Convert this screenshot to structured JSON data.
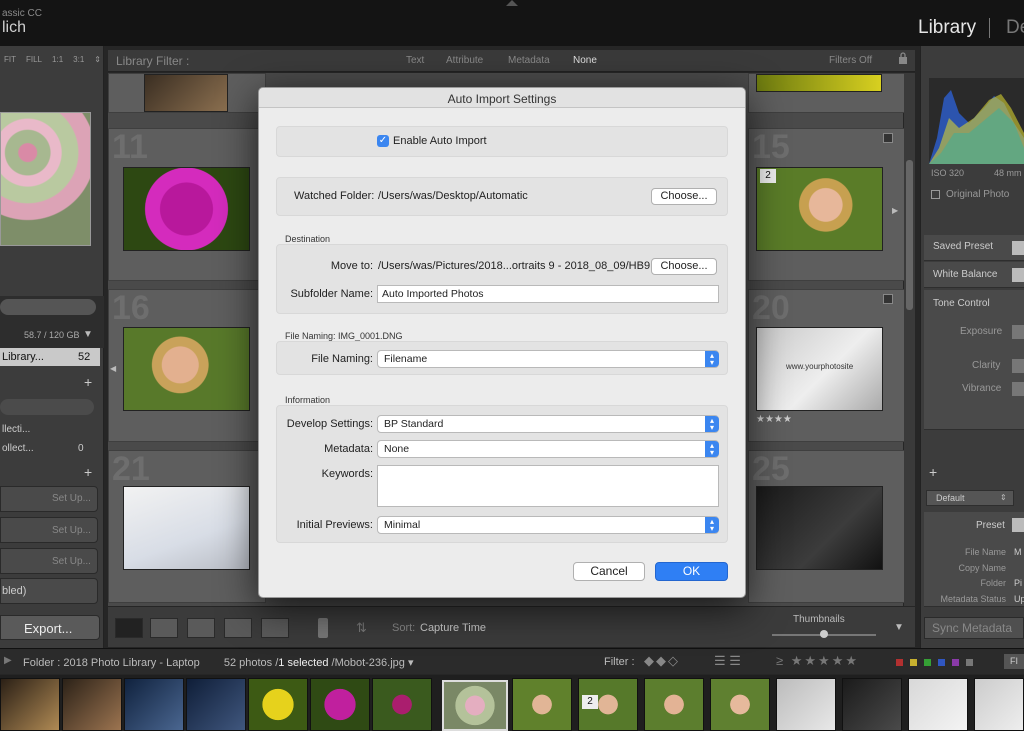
{
  "app": {
    "line1": "assic CC",
    "line2": "lich"
  },
  "modules": {
    "library": "Library",
    "develop": "De"
  },
  "navigator": {
    "modes": [
      "FIT",
      "FILL",
      "1:1",
      "3:1"
    ]
  },
  "left": {
    "storage": "58.7 / 120 GB",
    "library_label": "Library...",
    "library_count": "52",
    "collection1": "llecti...",
    "collection2": "ollect...",
    "collection2_count": "0",
    "setup": [
      "Set Up...",
      "Set Up...",
      "Set Up..."
    ],
    "disabled": "bled)",
    "export": "Export..."
  },
  "filterbar": {
    "title": "Library Filter :",
    "tabs": [
      "Text",
      "Attribute",
      "Metadata",
      "None"
    ],
    "filters_off": "Filters Off"
  },
  "grid": {
    "cell_numbers": [
      "11",
      "15",
      "16",
      "20",
      "21",
      "25"
    ],
    "stars": "★★★★",
    "cell_badge": "2",
    "browser_text": "www.yourphotosite"
  },
  "toolbar": {
    "sort_label": "Sort:",
    "sort_value": "Capture Time",
    "thumbnails": "Thumbnails"
  },
  "right": {
    "iso": "ISO 320",
    "mm": "48 mm",
    "original_photo": "Original Photo",
    "rows": [
      "Saved Preset",
      "White Balance",
      "Tone Control",
      "Exposure",
      "Clarity",
      "Vibrance"
    ],
    "default": "Default",
    "preset": "Preset",
    "meta_labels": [
      "File Name",
      "Copy Name",
      "Folder",
      "Metadata Status"
    ],
    "meta_values": [
      "M",
      "",
      "Pi",
      "Up"
    ],
    "sync": "Sync Metadata"
  },
  "filmbar": {
    "folder": "Folder : 2018 Photo Library - Laptop",
    "count": "52 photos /",
    "selected": "1 selected",
    "file": "/Mobot-236.jpg",
    "filter": "Filter :",
    "badge": "2",
    "filter_icon_label": "FI",
    "chip_colors": [
      "#b23030",
      "#c7b02f",
      "#35a035",
      "#3056c0",
      "#8a3aa8",
      "#777777"
    ]
  },
  "dialog": {
    "title": "Auto Import Settings",
    "enable_auto_import": "Enable Auto Import",
    "watched_folder_label": "Watched Folder:",
    "watched_folder_value": "/Users/was/Desktop/Automatic",
    "choose": "Choose...",
    "destination_header": "Destination",
    "move_to_label": "Move to:",
    "move_to_value": "/Users/was/Pictures/2018...ortraits 9 - 2018_08_09/HB9",
    "subfolder_label": "Subfolder Name:",
    "subfolder_value": "Auto Imported Photos",
    "file_naming_header": "File Naming:  IMG_0001.DNG",
    "file_naming_label": "File Naming:",
    "file_naming_value": "Filename",
    "information_header": "Information",
    "develop_label": "Develop Settings:",
    "develop_value": "BP Standard",
    "metadata_label": "Metadata:",
    "metadata_value": "None",
    "keywords_label": "Keywords:",
    "keywords_value": "",
    "previews_label": "Initial Previews:",
    "previews_value": "Minimal",
    "cancel": "Cancel",
    "ok": "OK"
  },
  "colors": {
    "accent": "#2f7ff4",
    "dialog_bg": "#ececec",
    "panel_bg": "#3c3c3c"
  }
}
